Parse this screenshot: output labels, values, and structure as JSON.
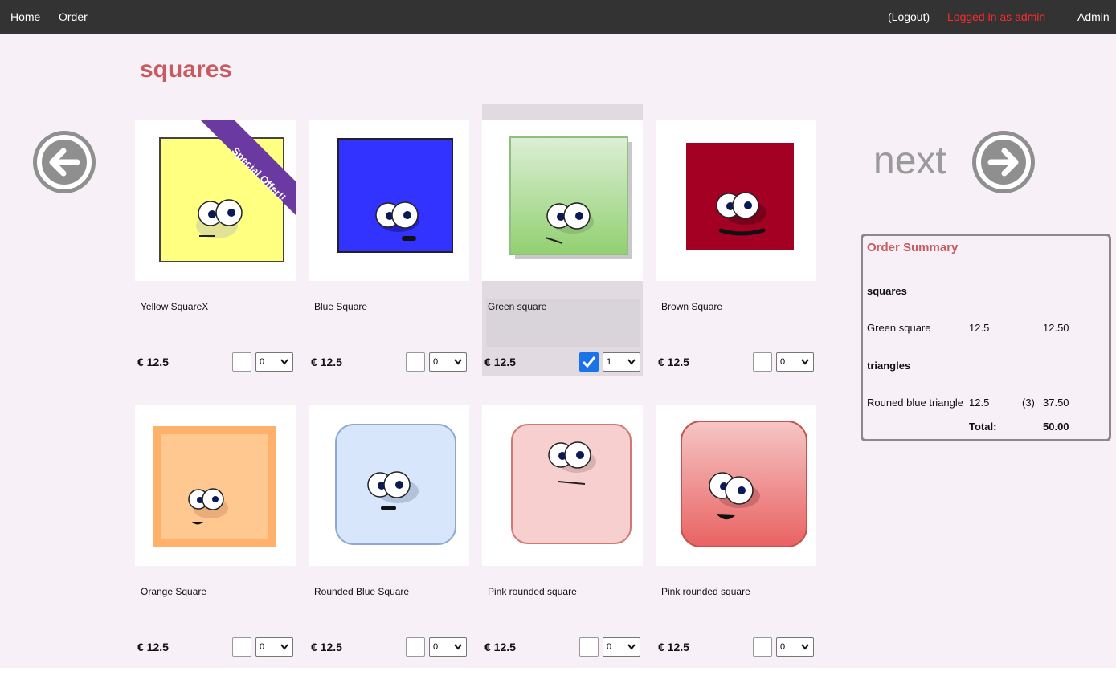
{
  "nav": {
    "home": "Home",
    "order": "Order",
    "logout": "(Logout)",
    "logged_in": "Logged in as admin",
    "admin": "Admin"
  },
  "category_title": "squares",
  "pager": {
    "next_label": "next"
  },
  "currency": "€",
  "colors": {
    "navbar": "#333333",
    "page_bg": "#f7f0f7",
    "accent": "#c75b5f",
    "logged_in": "#ff2a2a",
    "ribbon": "#6a3aa2"
  },
  "products": [
    {
      "name": "Yellow SquareX",
      "price": "€ 12.5",
      "qty": "0",
      "checked": false,
      "badge": "Special Offer!!"
    },
    {
      "name": "Blue Square",
      "price": "€ 12.5",
      "qty": "0",
      "checked": false
    },
    {
      "name": "Green square",
      "price": "€ 12.5",
      "qty": "1",
      "checked": true
    },
    {
      "name": "Brown Square",
      "price": "€ 12.5",
      "qty": "0",
      "checked": false
    },
    {
      "name": "Orange Square",
      "price": "€ 12.5",
      "qty": "0",
      "checked": false
    },
    {
      "name": "Rounded Blue Square",
      "price": "€ 12.5",
      "qty": "0",
      "checked": false
    },
    {
      "name": "Pink rounded square",
      "price": "€ 12.5",
      "qty": "0",
      "checked": false
    },
    {
      "name": "Pink rounded square",
      "price": "€ 12.5",
      "qty": "0",
      "checked": false
    }
  ],
  "summary": {
    "title": "Order Summary",
    "groups": [
      {
        "category": "squares",
        "items": [
          {
            "name": "Green square",
            "unit_price": "12.5",
            "count": "",
            "total": "12.50"
          }
        ]
      },
      {
        "category": "triangles",
        "items": [
          {
            "name": "Rouned blue triangle",
            "unit_price": "12.5",
            "count": "(3)",
            "total": "37.50"
          }
        ]
      }
    ],
    "total_label": "Total:",
    "total_value": "50.00"
  }
}
